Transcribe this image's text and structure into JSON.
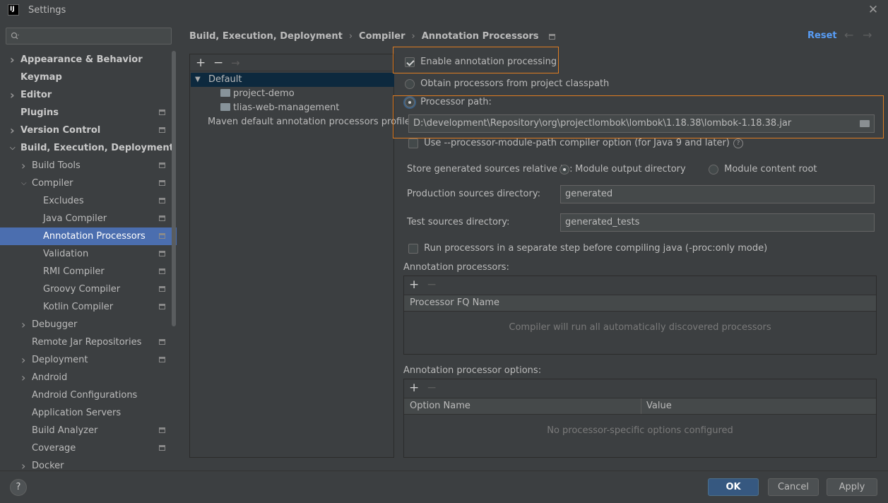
{
  "window": {
    "title": "Settings",
    "logo": "IJ"
  },
  "search": {
    "placeholder": "",
    "icon": "search-icon"
  },
  "sidebar": {
    "items": [
      {
        "label": "Appearance & Behavior",
        "level": 0,
        "chevron": "right",
        "bold": true,
        "gear": false
      },
      {
        "label": "Keymap",
        "level": 0,
        "chevron": "none",
        "bold": true,
        "gear": false
      },
      {
        "label": "Editor",
        "level": 0,
        "chevron": "right",
        "bold": true,
        "gear": false
      },
      {
        "label": "Plugins",
        "level": 0,
        "chevron": "none",
        "bold": true,
        "gear": true
      },
      {
        "label": "Version Control",
        "level": 0,
        "chevron": "right",
        "bold": true,
        "gear": true
      },
      {
        "label": "Build, Execution, Deployment",
        "level": 0,
        "chevron": "down",
        "bold": true,
        "gear": false
      },
      {
        "label": "Build Tools",
        "level": 1,
        "chevron": "right",
        "bold": false,
        "gear": true
      },
      {
        "label": "Compiler",
        "level": 1,
        "chevron": "down",
        "bold": false,
        "gear": true
      },
      {
        "label": "Excludes",
        "level": 2,
        "chevron": "none",
        "bold": false,
        "gear": true
      },
      {
        "label": "Java Compiler",
        "level": 2,
        "chevron": "none",
        "bold": false,
        "gear": true
      },
      {
        "label": "Annotation Processors",
        "level": 2,
        "chevron": "none",
        "bold": false,
        "gear": true,
        "selected": true
      },
      {
        "label": "Validation",
        "level": 2,
        "chevron": "none",
        "bold": false,
        "gear": true
      },
      {
        "label": "RMI Compiler",
        "level": 2,
        "chevron": "none",
        "bold": false,
        "gear": true
      },
      {
        "label": "Groovy Compiler",
        "level": 2,
        "chevron": "none",
        "bold": false,
        "gear": true
      },
      {
        "label": "Kotlin Compiler",
        "level": 2,
        "chevron": "none",
        "bold": false,
        "gear": true
      },
      {
        "label": "Debugger",
        "level": 1,
        "chevron": "right",
        "bold": false,
        "gear": false
      },
      {
        "label": "Remote Jar Repositories",
        "level": 1,
        "chevron": "none",
        "bold": false,
        "gear": true
      },
      {
        "label": "Deployment",
        "level": 1,
        "chevron": "right",
        "bold": false,
        "gear": true
      },
      {
        "label": "Android",
        "level": 1,
        "chevron": "right",
        "bold": false,
        "gear": false
      },
      {
        "label": "Android Configurations",
        "level": 1,
        "chevron": "none",
        "bold": false,
        "gear": false
      },
      {
        "label": "Application Servers",
        "level": 1,
        "chevron": "none",
        "bold": false,
        "gear": false
      },
      {
        "label": "Build Analyzer",
        "level": 1,
        "chevron": "none",
        "bold": false,
        "gear": true
      },
      {
        "label": "Coverage",
        "level": 1,
        "chevron": "none",
        "bold": false,
        "gear": true
      },
      {
        "label": "Docker",
        "level": 1,
        "chevron": "right",
        "bold": false,
        "gear": false
      }
    ]
  },
  "breadcrumb": {
    "items": [
      "Build, Execution, Deployment",
      "Compiler",
      "Annotation Processors"
    ],
    "separator": "›"
  },
  "header": {
    "reset_label": "Reset",
    "back_icon": "←",
    "forward_icon": "→"
  },
  "profiles": {
    "toolbar": {
      "add": "+",
      "remove": "−",
      "move": "→"
    },
    "tree": [
      {
        "label": "Default",
        "type": "group"
      },
      {
        "label": "project-demo",
        "type": "module"
      },
      {
        "label": "tlias-web-management",
        "type": "module"
      },
      {
        "label": "Maven default annotation processors profile",
        "type": "group"
      }
    ]
  },
  "settings": {
    "enable_label": "Enable annotation processing",
    "enable_checked": true,
    "obtain_label": "Obtain processors from project classpath",
    "processor_path_label": "Processor path:",
    "processor_path_value": "D:\\development\\Repository\\org\\projectlombok\\lombok\\1.18.38\\lombok-1.18.38.jar",
    "use_module_path_label": "Use --processor-module-path compiler option (for Java 9 and later)",
    "store_label": "Store generated sources relative to:",
    "module_output_label": "Module output directory",
    "module_content_label": "Module content root",
    "production_label": "Production sources directory:",
    "production_value": "generated",
    "test_label": "Test sources directory:",
    "test_value": "generated_tests",
    "run_separate_label": "Run processors in a separate step before compiling java (-proc:only mode)"
  },
  "processors_table": {
    "title": "Annotation processors:",
    "add": "+",
    "remove": "−",
    "column": "Processor FQ Name",
    "empty": "Compiler will run all automatically discovered processors"
  },
  "options_table": {
    "title": "Annotation processor options:",
    "add": "+",
    "remove": "−",
    "columns": [
      "Option Name",
      "Value"
    ],
    "empty": "No processor-specific options configured"
  },
  "footer": {
    "help": "?",
    "ok": "OK",
    "cancel": "Cancel",
    "apply": "Apply"
  },
  "colors": {
    "accent": "#4b6eaf",
    "highlight": "#e07d22",
    "link": "#589df6",
    "primary_button": "#365880"
  }
}
